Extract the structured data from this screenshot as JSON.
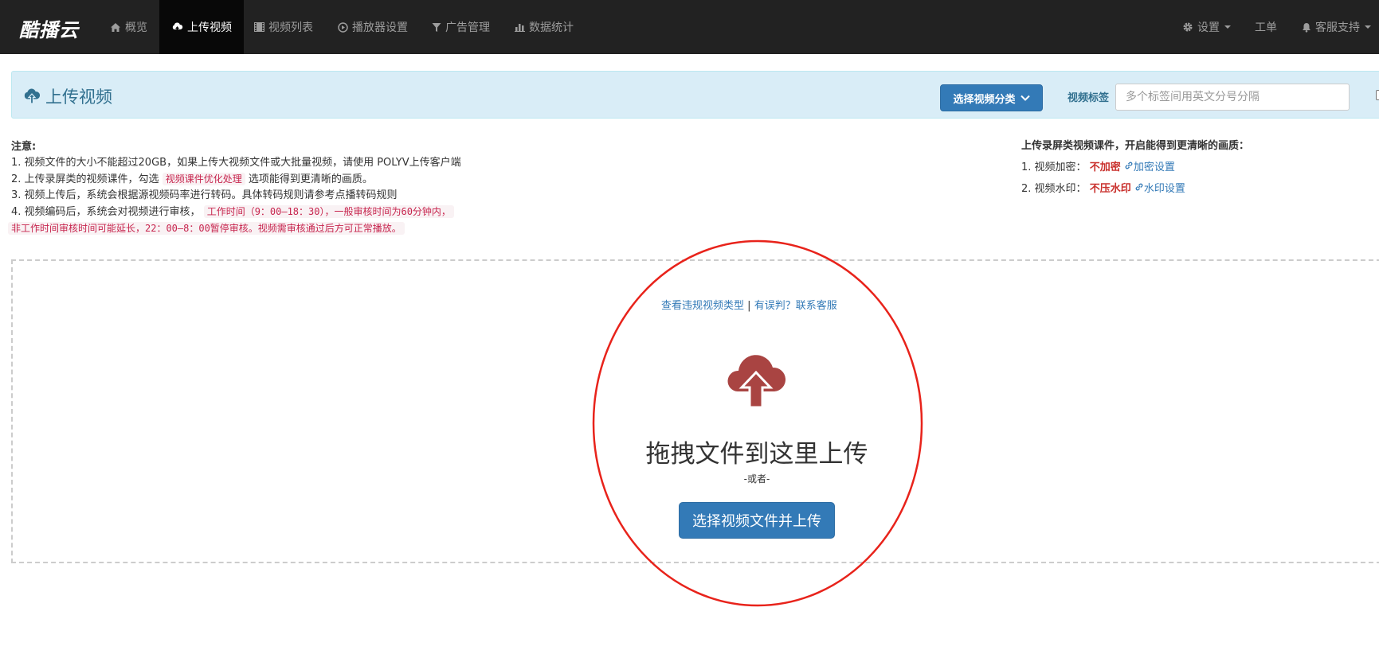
{
  "navbar": {
    "brand": "酷播云",
    "items": [
      {
        "label": "概览",
        "icon": "home-icon"
      },
      {
        "label": "上传视频",
        "icon": "cloud-upload-icon",
        "active": true
      },
      {
        "label": "视频列表",
        "icon": "film-icon"
      },
      {
        "label": "播放器设置",
        "icon": "play-circle-icon"
      },
      {
        "label": "广告管理",
        "icon": "filter-icon"
      },
      {
        "label": "数据统计",
        "icon": "bar-chart-icon"
      }
    ],
    "right": [
      {
        "label": "设置",
        "icon": "gear-icon",
        "dropdown": true
      },
      {
        "label": "工单"
      },
      {
        "label": "客服支持",
        "icon": "bell-icon",
        "dropdown": true
      }
    ]
  },
  "header": {
    "title": "上传视频",
    "category_button": "选择视频分类",
    "tag_label": "视频标签",
    "tag_placeholder": "多个标签间用英文分号分隔"
  },
  "notes": {
    "title": "注意:",
    "line1": "1. 视频文件的大小不能超过20GB，如果上传大视频文件或大批量视频，请使用 POLYV上传客户端",
    "line2_prefix": "2. 上传录屏类的视频课件，勾选",
    "line2_code": "视频课件优化处理",
    "line2_suffix": "选项能得到更清晰的画质。",
    "line3": "3. 视频上传后，系统会根据源视频码率进行转码。具体转码规则请参考点播转码规则",
    "line4_prefix": "4. 视频编码后，系统会对视频进行审核，",
    "line4_code1": "工作时间（9：00—18：30），一般审核时间为60分钟内，",
    "line4_code2": "非工作时间审核时间可能延长，22：00—8：00暂停审核。视频需审核通过后方可正常播放。"
  },
  "right_notes": {
    "title": "上传录屏类视频课件，开启能得到更清晰的画质：",
    "encrypt_label": "1. 视频加密：",
    "encrypt_value": "不加密",
    "encrypt_link": "加密设置",
    "watermark_label": "2. 视频水印：",
    "watermark_value": "不压水印",
    "watermark_link": "水印设置"
  },
  "dropzone": {
    "violation_link": "查看违规视频类型",
    "separator": "|",
    "appeal_link": "有误判？联系客服",
    "title": "拖拽文件到这里上传",
    "or": "-或者-",
    "upload_button": "选择视频文件并上传"
  },
  "colors": {
    "navbar": "#222222",
    "primary": "#337ab7",
    "info_bg": "#d9edf7",
    "danger": "#c9302c",
    "cloud_icon": "#a94442",
    "ring": "#e8231b"
  }
}
